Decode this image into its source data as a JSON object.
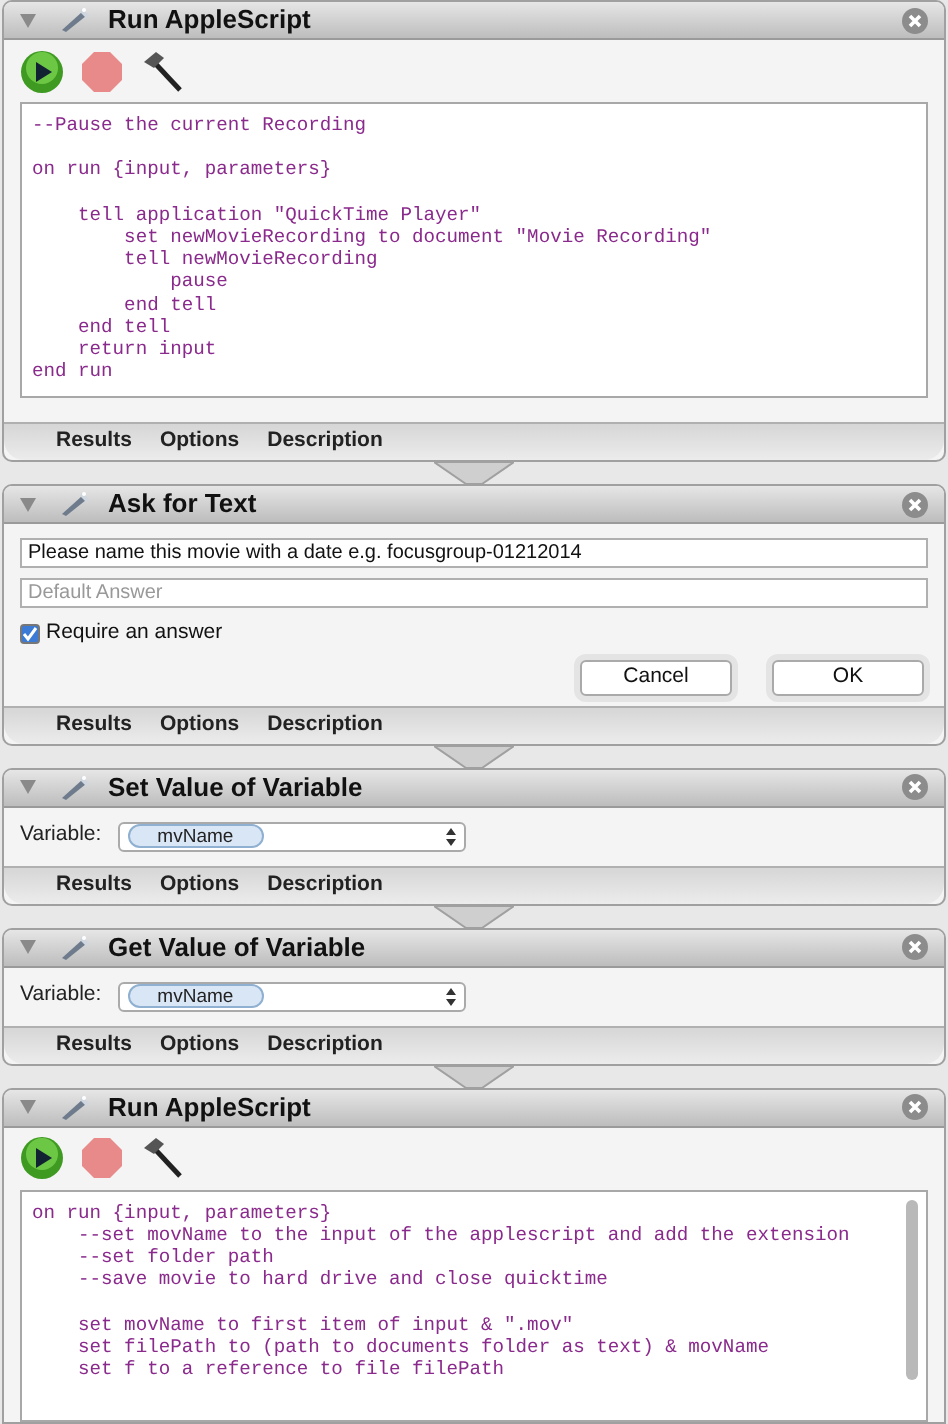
{
  "actions": [
    {
      "kind": "script",
      "title": "Run AppleScript",
      "code": [
        [
          "--Pause the current Recording"
        ],
        [
          "on run {input, parameters}"
        ],
        [
          "    tell application \"QuickTime Player\"",
          "        set newMovieRecording to document \"Movie Recording\"",
          "        tell newMovieRecording",
          "            pause",
          "        end tell",
          "    end tell",
          "    return input",
          "end run"
        ]
      ],
      "tabs": [
        "Results",
        "Options",
        "Description"
      ]
    },
    {
      "kind": "ask",
      "title": "Ask for Text",
      "prompt": "Please name this movie with a date e.g. focusgroup-01212014",
      "placeholder": "Default Answer",
      "require": {
        "label": "Require an answer",
        "checked": true
      },
      "buttons": [
        "Cancel",
        "OK"
      ],
      "tabs": [
        "Results",
        "Options",
        "Description"
      ]
    },
    {
      "kind": "variable",
      "title": "Set Value of Variable",
      "label": "Variable:",
      "value": "mvName",
      "tabs": [
        "Results",
        "Options",
        "Description"
      ]
    },
    {
      "kind": "variable",
      "title": "Get Value of Variable",
      "label": "Variable:",
      "value": "mvName",
      "tabs": [
        "Results",
        "Options",
        "Description"
      ]
    },
    {
      "kind": "script",
      "title": "Run AppleScript",
      "code": [
        [
          "on run {input, parameters}",
          "    --set movName to the input of the applescript and add the extension",
          "    --set folder path",
          "    --save movie to hard drive and close quicktime"
        ],
        [
          "    set movName to first item of input & \".mov\"",
          "    set filePath to (path to documents folder as text) & movName",
          "    set f to a reference to file filePath"
        ]
      ]
    }
  ]
}
